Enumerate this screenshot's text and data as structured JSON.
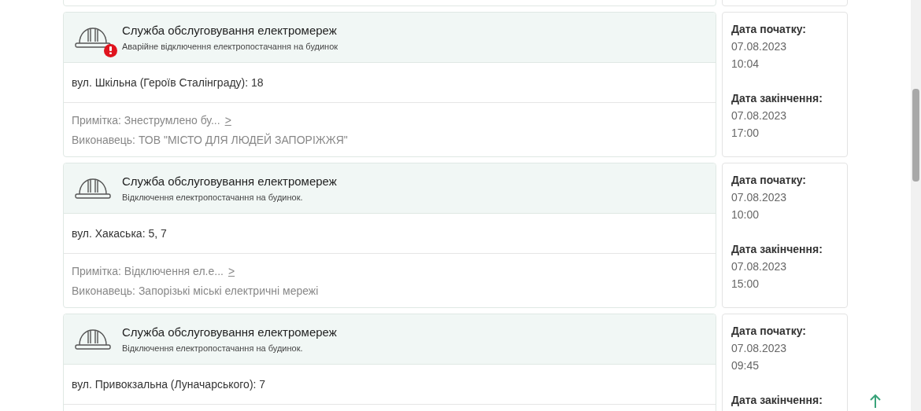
{
  "outages": [
    {
      "emergency": true,
      "service": "Служба обслуговування електромереж",
      "type": "Аварійне відключення електропостачання на будинок",
      "address": "вул. Шкільна (Героїв Сталінграду): 18",
      "note": "Примітка: Знеструмлено бу...",
      "more": ">",
      "contractor": "Виконавець: ТОВ \"МІСТО ДЛЯ ЛЮДЕЙ ЗАПОРІЖЖЯ\"",
      "start_label": "Дата початку:",
      "start_date": "07.08.2023",
      "start_time": "10:04",
      "end_label": "Дата закінчення:",
      "end_date": "07.08.2023",
      "end_time": "17:00"
    },
    {
      "emergency": false,
      "service": "Служба обслуговування електромереж",
      "type": "Відключення електропостачання на будинок.",
      "address": "вул. Хакаська: 5, 7",
      "note": "Примітка: Відключення ел.е...",
      "more": ">",
      "contractor": "Виконавець: Запорізькі міські електричні мережі",
      "start_label": "Дата початку:",
      "start_date": "07.08.2023",
      "start_time": "10:00",
      "end_label": "Дата закінчення:",
      "end_date": "07.08.2023",
      "end_time": "15:00"
    },
    {
      "emergency": false,
      "service": "Служба обслуговування електромереж",
      "type": "Відключення електропостачання на будинок.",
      "address": "вул. Привокзальна (Луначарського): 7",
      "start_label": "Дата початку:",
      "start_date": "07.08.2023",
      "start_time": "09:45",
      "end_label": "Дата закінчення:"
    }
  ]
}
